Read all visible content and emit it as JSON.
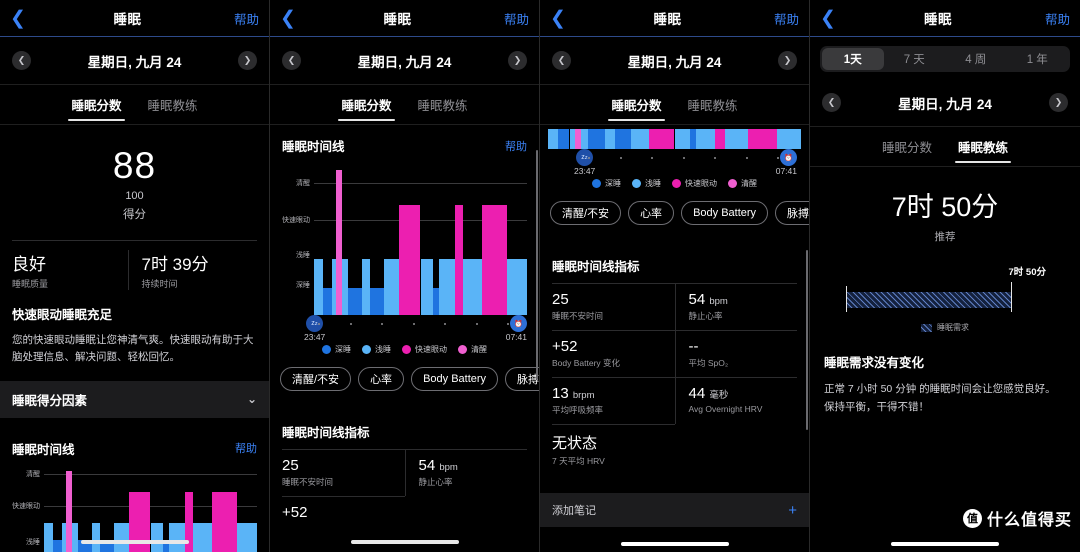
{
  "nav": {
    "back_icon": "chevron-left-icon",
    "title": "睡眠",
    "help": "帮助"
  },
  "date": {
    "prev_icon": "chevron-left-icon",
    "next_icon": "chevron-right-icon",
    "label": "星期日, 九月 24"
  },
  "tabs": {
    "score": "睡眠分数",
    "coach": "睡眠教练"
  },
  "range": {
    "options": [
      "1天",
      "7 天",
      "4 周",
      "1 年"
    ],
    "selected": "1天"
  },
  "score": {
    "value": "88",
    "denominator": "100",
    "label": "得分",
    "quality_value": "良好",
    "quality_label": "睡眠质量",
    "duration_value": "7时 39分",
    "duration_label": "持续时间"
  },
  "insight": {
    "heading": "快速眼动睡眠充足",
    "body": "您的快速眼动睡眠让您神清气爽。快速眼动有助于大脑处理信息、解决问题、轻松回忆。"
  },
  "factors_row": {
    "label": "睡眠得分因素",
    "chevron_icon": "chevron-down-icon"
  },
  "timeline": {
    "title": "睡眠时间线",
    "help": "帮助"
  },
  "axis": {
    "start_time": "23:47",
    "end_time": "07:41",
    "start_icon": "sleep-zzz-icon",
    "end_icon": "alarm-clock-icon",
    "dot_count": 7
  },
  "legend": [
    {
      "label": "深睡",
      "color": "#1f74e0"
    },
    {
      "label": "浅睡",
      "color": "#5ab4f7"
    },
    {
      "label": "快速眼动",
      "color": "#ec1fb0"
    },
    {
      "label": "清醒",
      "color": "#f05fd0"
    }
  ],
  "chips": [
    "清醒/不安",
    "心率",
    "Body Battery",
    "脉搏"
  ],
  "metrics_title": "睡眠时间线指标",
  "metrics": [
    {
      "value": "25",
      "unit": "",
      "label": "睡眠不安时间"
    },
    {
      "value": "54",
      "unit": "bpm",
      "label": "静止心率"
    },
    {
      "value": "+52",
      "unit": "",
      "label": "Body Battery 变化"
    },
    {
      "value": "--",
      "unit": "",
      "label": "平均 SpO₂"
    },
    {
      "value": "13",
      "unit": "brpm",
      "label": "平均呼吸频率"
    },
    {
      "value": "44",
      "unit": "毫秒",
      "label": "Avg Overnight HRV"
    },
    {
      "value": "无状态",
      "unit": "",
      "label": "7 天平均 HRV"
    }
  ],
  "note": {
    "label": "添加笔记",
    "plus_icon": "plus-icon"
  },
  "coach": {
    "recommended_value": "7时 50分",
    "recommended_label": "推荐",
    "bar_caption": "7时 50分",
    "legend_label": "睡眠需求",
    "heading": "睡眠需求没有变化",
    "body": "正常 7 小时 50 分钟 的睡眠时间会让您感觉良好。保持平衡，干得不错！"
  },
  "watermark": {
    "badge": "值",
    "text": "什么值得买"
  },
  "chart_data": {
    "type": "bar",
    "title": "睡眠时间线",
    "xlabel": "",
    "ylabel": "",
    "grid": true,
    "legend_position": "bottom",
    "stage_levels": [
      "深睡",
      "浅睡",
      "快速眼动",
      "清醒"
    ],
    "ytick_labels": [
      "清醒",
      "快速眼动",
      "浅睡",
      "深睡"
    ],
    "x_range": [
      "23:47",
      "07:41"
    ],
    "stage_colors": {
      "深睡": "#1f74e0",
      "浅睡": "#5ab4f7",
      "快速眼动": "#ec1fb0",
      "清醒": "#f05fd0"
    },
    "segments": [
      {
        "start": 0.0,
        "end": 0.04,
        "stage": "浅睡"
      },
      {
        "start": 0.04,
        "end": 0.085,
        "stage": "深睡"
      },
      {
        "start": 0.085,
        "end": 0.105,
        "stage": "浅睡"
      },
      {
        "start": 0.105,
        "end": 0.13,
        "stage": "清醒"
      },
      {
        "start": 0.13,
        "end": 0.16,
        "stage": "浅睡"
      },
      {
        "start": 0.16,
        "end": 0.225,
        "stage": "深睡"
      },
      {
        "start": 0.225,
        "end": 0.265,
        "stage": "浅睡"
      },
      {
        "start": 0.265,
        "end": 0.33,
        "stage": "深睡"
      },
      {
        "start": 0.33,
        "end": 0.4,
        "stage": "浅睡"
      },
      {
        "start": 0.4,
        "end": 0.5,
        "stage": "快速眼动"
      },
      {
        "start": 0.5,
        "end": 0.56,
        "stage": "浅睡"
      },
      {
        "start": 0.56,
        "end": 0.585,
        "stage": "深睡"
      },
      {
        "start": 0.585,
        "end": 0.66,
        "stage": "浅睡"
      },
      {
        "start": 0.66,
        "end": 0.7,
        "stage": "快速眼动"
      },
      {
        "start": 0.7,
        "end": 0.79,
        "stage": "浅睡"
      },
      {
        "start": 0.79,
        "end": 0.905,
        "stage": "快速眼动"
      },
      {
        "start": 0.905,
        "end": 1.0,
        "stage": "浅睡"
      }
    ],
    "sleep_need": {
      "label": "睡眠需求",
      "value_text": "7时 50分",
      "fill_fraction": 1.0
    }
  }
}
